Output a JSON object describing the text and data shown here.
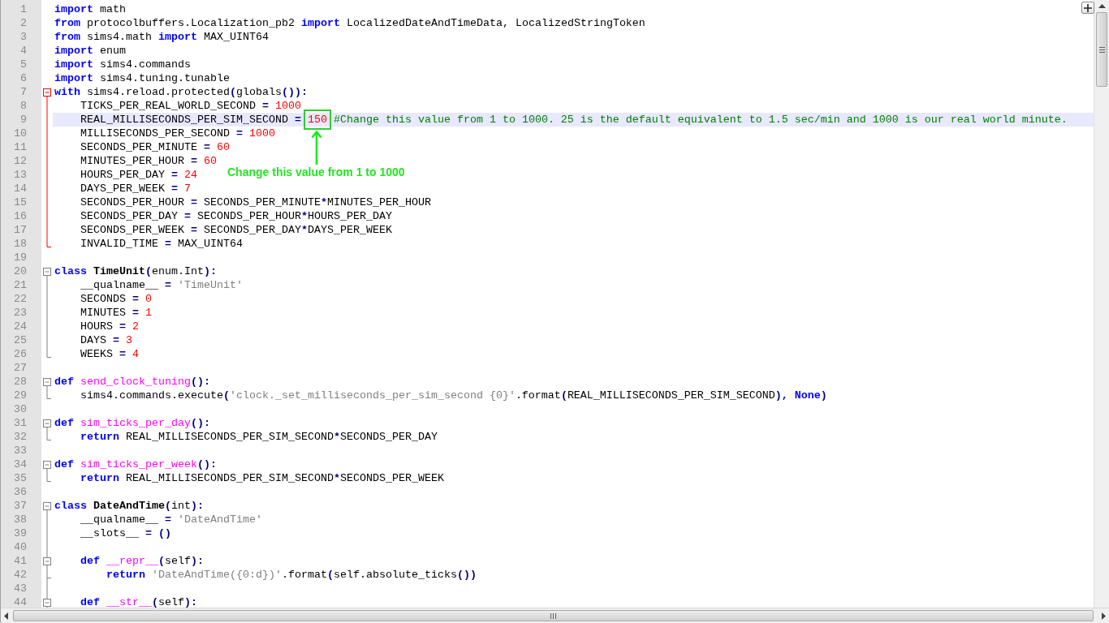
{
  "editor": {
    "lines": [
      {
        "number": "1",
        "highlighted": false,
        "tokens": [
          {
            "kind": "keyword",
            "text": "import"
          },
          {
            "kind": "plain",
            "text": " math"
          }
        ]
      },
      {
        "number": "2",
        "highlighted": false,
        "tokens": [
          {
            "kind": "keyword",
            "text": "from"
          },
          {
            "kind": "plain",
            "text": " protocolbuffers.Localization_pb2 "
          },
          {
            "kind": "keyword",
            "text": "import"
          },
          {
            "kind": "plain",
            "text": " LocalizedDateAndTimeData, LocalizedStringToken"
          }
        ]
      },
      {
        "number": "3",
        "highlighted": false,
        "tokens": [
          {
            "kind": "keyword",
            "text": "from"
          },
          {
            "kind": "plain",
            "text": " sims4.math "
          },
          {
            "kind": "keyword",
            "text": "import"
          },
          {
            "kind": "plain",
            "text": " MAX_UINT64"
          }
        ]
      },
      {
        "number": "4",
        "highlighted": false,
        "tokens": [
          {
            "kind": "keyword",
            "text": "import"
          },
          {
            "kind": "plain",
            "text": " enum"
          }
        ]
      },
      {
        "number": "5",
        "highlighted": false,
        "tokens": [
          {
            "kind": "keyword",
            "text": "import"
          },
          {
            "kind": "plain",
            "text": " sims4.commands"
          }
        ]
      },
      {
        "number": "6",
        "highlighted": false,
        "tokens": [
          {
            "kind": "keyword",
            "text": "import"
          },
          {
            "kind": "plain",
            "text": " sims4.tuning.tunable"
          }
        ]
      },
      {
        "number": "7",
        "highlighted": false,
        "fold": {
          "kind": "head",
          "active": true
        },
        "tokens": [
          {
            "kind": "keyword",
            "text": "with"
          },
          {
            "kind": "plain",
            "text": " sims4.reload.protected"
          },
          {
            "kind": "operator",
            "text": "("
          },
          {
            "kind": "plain",
            "text": "globals"
          },
          {
            "kind": "operator",
            "text": "()):"
          }
        ]
      },
      {
        "number": "8",
        "highlighted": false,
        "fold": {
          "kind": "body",
          "active": true
        },
        "tokens": [
          {
            "kind": "plain",
            "text": "    TICKS_PER_REAL_WORLD_SECOND "
          },
          {
            "kind": "operator",
            "text": "= "
          },
          {
            "kind": "number",
            "text": "1000"
          }
        ]
      },
      {
        "number": "9",
        "highlighted": true,
        "fold": {
          "kind": "body",
          "active": true
        },
        "tokens": [
          {
            "kind": "plain",
            "text": "    REAL_MILLISECONDS_PER_SIM_SECOND "
          },
          {
            "kind": "operator",
            "text": "= "
          },
          {
            "kind": "number",
            "text": "150",
            "boxed": true
          },
          {
            "kind": "comment",
            "text": " #Change this value from 1 to 1000. 25 is the default equivalent to 1.5 sec/min and 1000 is our real world minute."
          }
        ]
      },
      {
        "number": "10",
        "highlighted": false,
        "fold": {
          "kind": "body",
          "active": true
        },
        "tokens": [
          {
            "kind": "plain",
            "text": "    MILLISECONDS_PER_SECOND "
          },
          {
            "kind": "operator",
            "text": "= "
          },
          {
            "kind": "number",
            "text": "1000"
          }
        ]
      },
      {
        "number": "11",
        "highlighted": false,
        "fold": {
          "kind": "body",
          "active": true
        },
        "tokens": [
          {
            "kind": "plain",
            "text": "    SECONDS_PER_MINUTE "
          },
          {
            "kind": "operator",
            "text": "= "
          },
          {
            "kind": "number",
            "text": "60"
          }
        ]
      },
      {
        "number": "12",
        "highlighted": false,
        "fold": {
          "kind": "body",
          "active": true
        },
        "tokens": [
          {
            "kind": "plain",
            "text": "    MINUTES_PER_HOUR "
          },
          {
            "kind": "operator",
            "text": "= "
          },
          {
            "kind": "number",
            "text": "60"
          }
        ]
      },
      {
        "number": "13",
        "highlighted": false,
        "fold": {
          "kind": "body",
          "active": true
        },
        "tokens": [
          {
            "kind": "plain",
            "text": "    HOURS_PER_DAY "
          },
          {
            "kind": "operator",
            "text": "= "
          },
          {
            "kind": "number",
            "text": "24"
          }
        ]
      },
      {
        "number": "14",
        "highlighted": false,
        "fold": {
          "kind": "body",
          "active": true
        },
        "tokens": [
          {
            "kind": "plain",
            "text": "    DAYS_PER_WEEK "
          },
          {
            "kind": "operator",
            "text": "= "
          },
          {
            "kind": "number",
            "text": "7"
          }
        ]
      },
      {
        "number": "15",
        "highlighted": false,
        "fold": {
          "kind": "body",
          "active": true
        },
        "tokens": [
          {
            "kind": "plain",
            "text": "    SECONDS_PER_HOUR "
          },
          {
            "kind": "operator",
            "text": "="
          },
          {
            "kind": "plain",
            "text": " SECONDS_PER_MINUTE"
          },
          {
            "kind": "operator",
            "text": "*"
          },
          {
            "kind": "plain",
            "text": "MINUTES_PER_HOUR"
          }
        ]
      },
      {
        "number": "16",
        "highlighted": false,
        "fold": {
          "kind": "body",
          "active": true
        },
        "tokens": [
          {
            "kind": "plain",
            "text": "    SECONDS_PER_DAY "
          },
          {
            "kind": "operator",
            "text": "="
          },
          {
            "kind": "plain",
            "text": " SECONDS_PER_HOUR"
          },
          {
            "kind": "operator",
            "text": "*"
          },
          {
            "kind": "plain",
            "text": "HOURS_PER_DAY"
          }
        ]
      },
      {
        "number": "17",
        "highlighted": false,
        "fold": {
          "kind": "body",
          "active": true
        },
        "tokens": [
          {
            "kind": "plain",
            "text": "    SECONDS_PER_WEEK "
          },
          {
            "kind": "operator",
            "text": "="
          },
          {
            "kind": "plain",
            "text": " SECONDS_PER_DAY"
          },
          {
            "kind": "operator",
            "text": "*"
          },
          {
            "kind": "plain",
            "text": "DAYS_PER_WEEK"
          }
        ]
      },
      {
        "number": "18",
        "highlighted": false,
        "fold": {
          "kind": "end",
          "active": true
        },
        "tokens": [
          {
            "kind": "plain",
            "text": "    INVALID_TIME "
          },
          {
            "kind": "operator",
            "text": "="
          },
          {
            "kind": "plain",
            "text": " MAX_UINT64"
          }
        ]
      },
      {
        "number": "19",
        "highlighted": false
      },
      {
        "number": "20",
        "highlighted": false,
        "fold": {
          "kind": "head",
          "active": false
        },
        "tokens": [
          {
            "kind": "keyword",
            "text": "class "
          },
          {
            "kind": "classname",
            "text": "TimeUnit"
          },
          {
            "kind": "operator",
            "text": "("
          },
          {
            "kind": "plain",
            "text": "enum.Int"
          },
          {
            "kind": "operator",
            "text": "):"
          }
        ]
      },
      {
        "number": "21",
        "highlighted": false,
        "fold": {
          "kind": "body",
          "active": false
        },
        "tokens": [
          {
            "kind": "plain",
            "text": "    __qualname__ "
          },
          {
            "kind": "operator",
            "text": "= "
          },
          {
            "kind": "string",
            "text": "'TimeUnit'"
          }
        ]
      },
      {
        "number": "22",
        "highlighted": false,
        "fold": {
          "kind": "body",
          "active": false
        },
        "tokens": [
          {
            "kind": "plain",
            "text": "    SECONDS "
          },
          {
            "kind": "operator",
            "text": "= "
          },
          {
            "kind": "number",
            "text": "0"
          }
        ]
      },
      {
        "number": "23",
        "highlighted": false,
        "fold": {
          "kind": "body",
          "active": false
        },
        "tokens": [
          {
            "kind": "plain",
            "text": "    MINUTES "
          },
          {
            "kind": "operator",
            "text": "= "
          },
          {
            "kind": "number",
            "text": "1"
          }
        ]
      },
      {
        "number": "24",
        "highlighted": false,
        "fold": {
          "kind": "body",
          "active": false
        },
        "tokens": [
          {
            "kind": "plain",
            "text": "    HOURS "
          },
          {
            "kind": "operator",
            "text": "= "
          },
          {
            "kind": "number",
            "text": "2"
          }
        ]
      },
      {
        "number": "25",
        "highlighted": false,
        "fold": {
          "kind": "body",
          "active": false
        },
        "tokens": [
          {
            "kind": "plain",
            "text": "    DAYS "
          },
          {
            "kind": "operator",
            "text": "= "
          },
          {
            "kind": "number",
            "text": "3"
          }
        ]
      },
      {
        "number": "26",
        "highlighted": false,
        "fold": {
          "kind": "end",
          "active": false
        },
        "tokens": [
          {
            "kind": "plain",
            "text": "    WEEKS "
          },
          {
            "kind": "operator",
            "text": "= "
          },
          {
            "kind": "number",
            "text": "4"
          }
        ]
      },
      {
        "number": "27",
        "highlighted": false
      },
      {
        "number": "28",
        "highlighted": false,
        "fold": {
          "kind": "head",
          "active": false
        },
        "tokens": [
          {
            "kind": "keyword",
            "text": "def "
          },
          {
            "kind": "function",
            "text": "send_clock_tuning"
          },
          {
            "kind": "operator",
            "text": "():"
          }
        ]
      },
      {
        "number": "29",
        "highlighted": false,
        "fold": {
          "kind": "end",
          "active": false
        },
        "tokens": [
          {
            "kind": "plain",
            "text": "    sims4.commands.execute"
          },
          {
            "kind": "operator",
            "text": "("
          },
          {
            "kind": "string",
            "text": "'clock._set_milliseconds_per_sim_second {0}'"
          },
          {
            "kind": "plain",
            "text": ".format"
          },
          {
            "kind": "operator",
            "text": "("
          },
          {
            "kind": "plain",
            "text": "REAL_MILLISECONDS_PER_SIM_SECOND"
          },
          {
            "kind": "operator",
            "text": "), "
          },
          {
            "kind": "keyword",
            "text": "None"
          },
          {
            "kind": "operator",
            "text": ")"
          }
        ]
      },
      {
        "number": "30",
        "highlighted": false
      },
      {
        "number": "31",
        "highlighted": false,
        "fold": {
          "kind": "head",
          "active": false
        },
        "tokens": [
          {
            "kind": "keyword",
            "text": "def "
          },
          {
            "kind": "function",
            "text": "sim_ticks_per_day"
          },
          {
            "kind": "operator",
            "text": "():"
          }
        ]
      },
      {
        "number": "32",
        "highlighted": false,
        "fold": {
          "kind": "end",
          "active": false
        },
        "tokens": [
          {
            "kind": "keyword",
            "text": "    return"
          },
          {
            "kind": "plain",
            "text": " REAL_MILLISECONDS_PER_SIM_SECOND"
          },
          {
            "kind": "operator",
            "text": "*"
          },
          {
            "kind": "plain",
            "text": "SECONDS_PER_DAY"
          }
        ]
      },
      {
        "number": "33",
        "highlighted": false
      },
      {
        "number": "34",
        "highlighted": false,
        "fold": {
          "kind": "head",
          "active": false
        },
        "tokens": [
          {
            "kind": "keyword",
            "text": "def "
          },
          {
            "kind": "function",
            "text": "sim_ticks_per_week"
          },
          {
            "kind": "operator",
            "text": "():"
          }
        ]
      },
      {
        "number": "35",
        "highlighted": false,
        "fold": {
          "kind": "end",
          "active": false
        },
        "tokens": [
          {
            "kind": "keyword",
            "text": "    return"
          },
          {
            "kind": "plain",
            "text": " REAL_MILLISECONDS_PER_SIM_SECOND"
          },
          {
            "kind": "operator",
            "text": "*"
          },
          {
            "kind": "plain",
            "text": "SECONDS_PER_WEEK"
          }
        ]
      },
      {
        "number": "36",
        "highlighted": false
      },
      {
        "number": "37",
        "highlighted": false,
        "fold": {
          "kind": "head",
          "active": false
        },
        "tokens": [
          {
            "kind": "keyword",
            "text": "class "
          },
          {
            "kind": "classname",
            "text": "DateAndTime"
          },
          {
            "kind": "operator",
            "text": "("
          },
          {
            "kind": "plain",
            "text": "int"
          },
          {
            "kind": "operator",
            "text": "):"
          }
        ]
      },
      {
        "number": "38",
        "highlighted": false,
        "fold": {
          "kind": "body",
          "active": false
        },
        "tokens": [
          {
            "kind": "plain",
            "text": "    __qualname__ "
          },
          {
            "kind": "operator",
            "text": "= "
          },
          {
            "kind": "string",
            "text": "'DateAndTime'"
          }
        ]
      },
      {
        "number": "39",
        "highlighted": false,
        "fold": {
          "kind": "body",
          "active": false
        },
        "tokens": [
          {
            "kind": "plain",
            "text": "    __slots__ "
          },
          {
            "kind": "operator",
            "text": "= ()"
          }
        ]
      },
      {
        "number": "40",
        "highlighted": false,
        "fold": {
          "kind": "body",
          "active": false
        }
      },
      {
        "number": "41",
        "highlighted": false,
        "fold": {
          "kind": "inner-head",
          "active": false
        },
        "tokens": [
          {
            "kind": "keyword",
            "text": "    def "
          },
          {
            "kind": "function",
            "text": "__repr__"
          },
          {
            "kind": "operator",
            "text": "("
          },
          {
            "kind": "plain",
            "text": "self"
          },
          {
            "kind": "operator",
            "text": "):"
          }
        ]
      },
      {
        "number": "42",
        "highlighted": false,
        "fold": {
          "kind": "tee",
          "active": false
        },
        "tokens": [
          {
            "kind": "keyword",
            "text": "        return "
          },
          {
            "kind": "string",
            "text": "'DateAndTime({0:d})'"
          },
          {
            "kind": "plain",
            "text": ".format"
          },
          {
            "kind": "operator",
            "text": "("
          },
          {
            "kind": "plain",
            "text": "self.absolute_ticks"
          },
          {
            "kind": "operator",
            "text": "())"
          }
        ]
      },
      {
        "number": "43",
        "highlighted": false,
        "fold": {
          "kind": "body",
          "active": false
        }
      },
      {
        "number": "44",
        "highlighted": false,
        "fold": {
          "kind": "inner-head",
          "active": false
        },
        "tokens": [
          {
            "kind": "keyword",
            "text": "    def "
          },
          {
            "kind": "function",
            "text": "__str__"
          },
          {
            "kind": "operator",
            "text": "("
          },
          {
            "kind": "plain",
            "text": "self"
          },
          {
            "kind": "operator",
            "text": "):"
          }
        ]
      }
    ]
  },
  "callout": {
    "text": "Change this value from 1 to 1000"
  }
}
